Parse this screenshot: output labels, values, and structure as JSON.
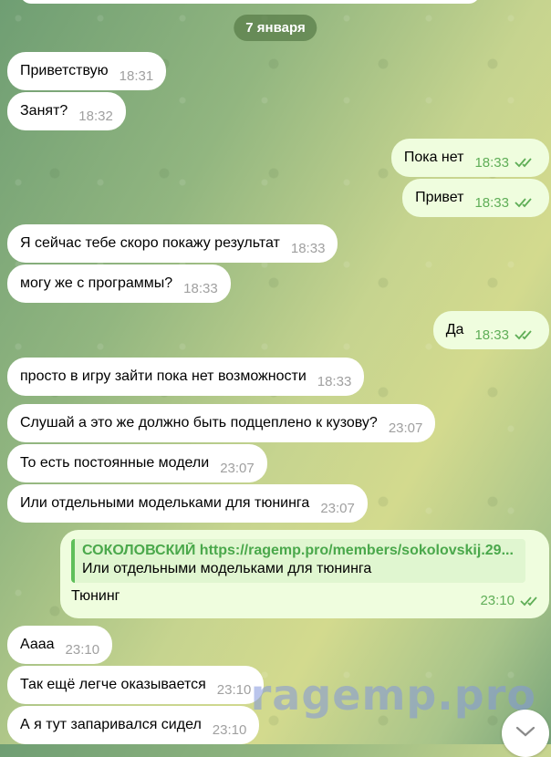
{
  "chat": {
    "date_label": "7 января",
    "messages": [
      {
        "dir": "in",
        "text": "Приветствую",
        "time": "18:31"
      },
      {
        "dir": "in",
        "text": "Занят?",
        "time": "18:32"
      },
      {
        "dir": "out",
        "text": "Пока нет",
        "time": "18:33"
      },
      {
        "dir": "out",
        "text": "Привет",
        "time": "18:33"
      },
      {
        "dir": "in",
        "text": "Я сейчас тебе скоро покажу результат",
        "time": "18:33"
      },
      {
        "dir": "in",
        "text": "могу же с программы?",
        "time": "18:33"
      },
      {
        "dir": "out",
        "text": "Да",
        "time": "18:33"
      },
      {
        "dir": "in",
        "text": "просто в игру зайти пока нет возможности",
        "time": "18:33"
      },
      {
        "dir": "in",
        "text": "Слушай а это же должно быть подцеплено к кузову?",
        "time": "23:07"
      },
      {
        "dir": "in",
        "text": "То есть постоянные модели",
        "time": "23:07"
      },
      {
        "dir": "in",
        "text": "Или отдельными модельками для тюнинга",
        "time": "23:07"
      },
      {
        "dir": "in",
        "text": "Аааа",
        "time": "23:10"
      },
      {
        "dir": "in",
        "text": "Так ещё легче оказывается",
        "time": "23:10"
      },
      {
        "dir": "in",
        "text": "А я тут запаривался сидел",
        "time": "23:10"
      }
    ],
    "reply_message": {
      "quote_author": "СОКОЛОВСКИЙ https://ragemp.pro/members/sokolovskij.29...",
      "quote_text": "Или отдельными модельками для тюнинга",
      "text": "Тюнинг",
      "time": "23:10"
    },
    "watermark": "ragemp.pro"
  },
  "colors": {
    "incoming": "#ffffff",
    "outgoing": "#effdde",
    "accent": "#5fae57",
    "quote_author": "#4aa84b"
  }
}
